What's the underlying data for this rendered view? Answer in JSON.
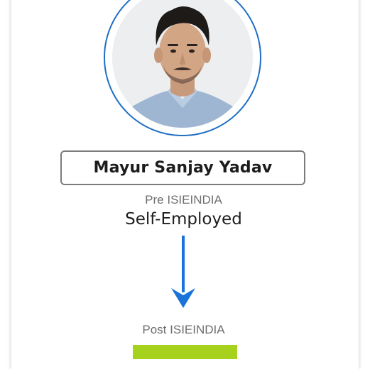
{
  "profile": {
    "name": "Mayur Sanjay Yadav",
    "photo_alt": "Portrait photo",
    "pre_label": "Pre ISIEINDIA",
    "pre_status": "Self-Employed",
    "post_label": "Post ISIEINDIA",
    "post_status": ""
  },
  "icons": {
    "transition": "arrow-down-icon"
  },
  "colors": {
    "ring": "#1f6fc4",
    "arrow": "#1a73d9",
    "name_border": "#7c7c7c",
    "post_badge": "#a6d11c"
  }
}
